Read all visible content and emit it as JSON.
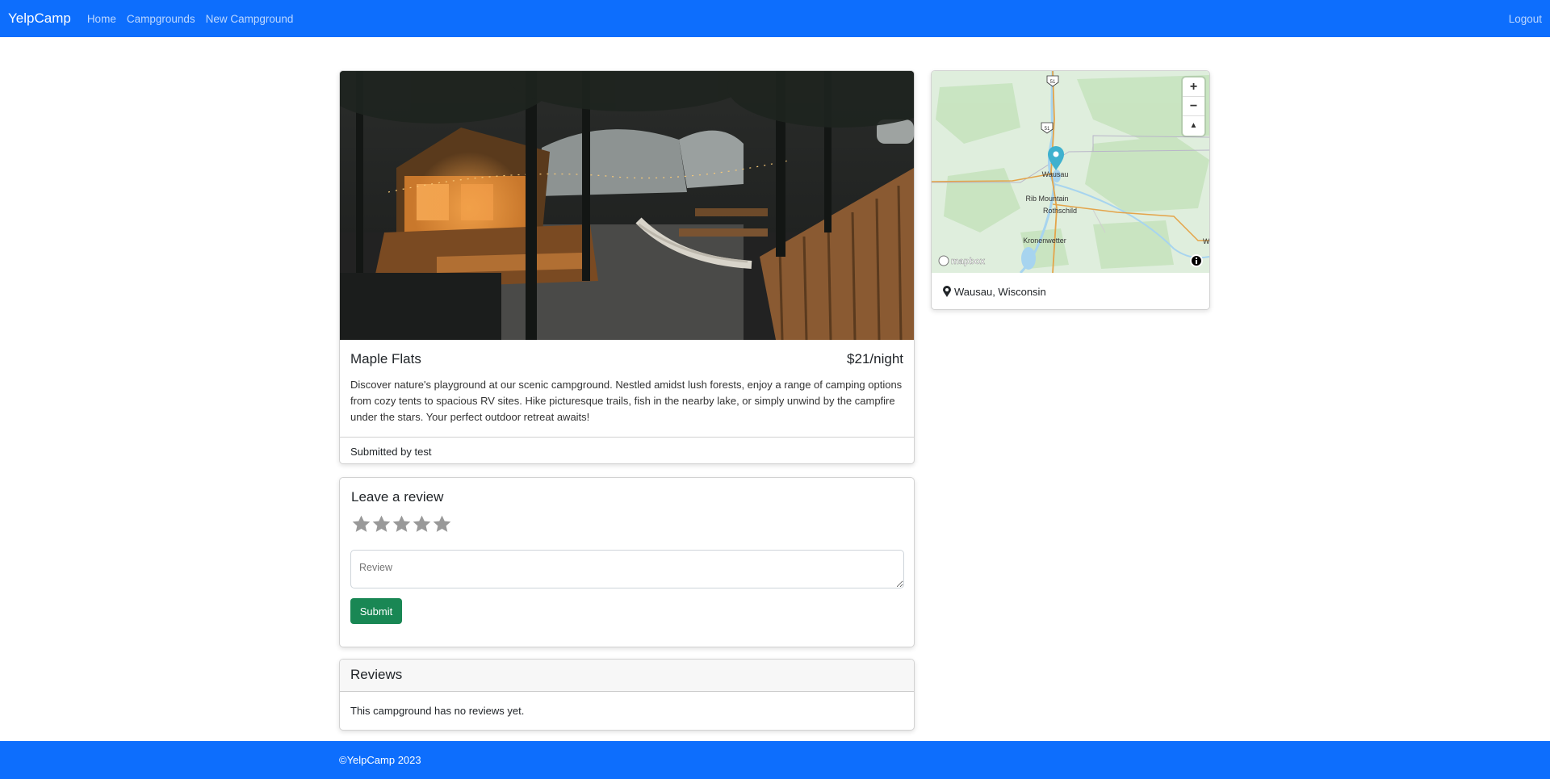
{
  "navbar": {
    "brand": "YelpCamp",
    "links": [
      "Home",
      "Campgrounds",
      "New Campground"
    ],
    "logout": "Logout"
  },
  "campground": {
    "title": "Maple Flats",
    "price": "$21/night",
    "description": "Discover nature's playground at our scenic campground. Nestled amidst lush forests, enjoy a range of camping options from cozy tents to spacious RV sites. Hike picturesque trails, fish in the nearby lake, or simply unwind by the campfire under the stars. Your perfect outdoor retreat awaits!",
    "submitted_by": "Submitted by test",
    "photo_icon": "campground-photo"
  },
  "map": {
    "location": "Wausau, Wisconsin",
    "labels": {
      "wausau": "Wausau",
      "rib_mountain": "Rib Mountain",
      "rothschild": "Rothschild",
      "kronenwetter": "Kronenwetter",
      "edge": "W",
      "highway": "51",
      "attribution": "mapbox"
    },
    "controls": {
      "zoom_in": "+",
      "zoom_out": "−",
      "compass": "▲"
    },
    "colors": {
      "land": "#dfeedd",
      "water": "#a7d4ef",
      "marker": "#3fb1ce",
      "highway": "#e4a44a"
    }
  },
  "review_form": {
    "heading": "Leave a review",
    "rating_options": 5,
    "placeholder": "Review",
    "submit_label": "Submit"
  },
  "reviews": {
    "heading": "Reviews",
    "empty_text": "This campground has no reviews yet."
  },
  "footer": {
    "text": "©YelpCamp 2023"
  },
  "colors": {
    "primary": "#0d6efd",
    "success": "#198754",
    "star": "#999999"
  }
}
